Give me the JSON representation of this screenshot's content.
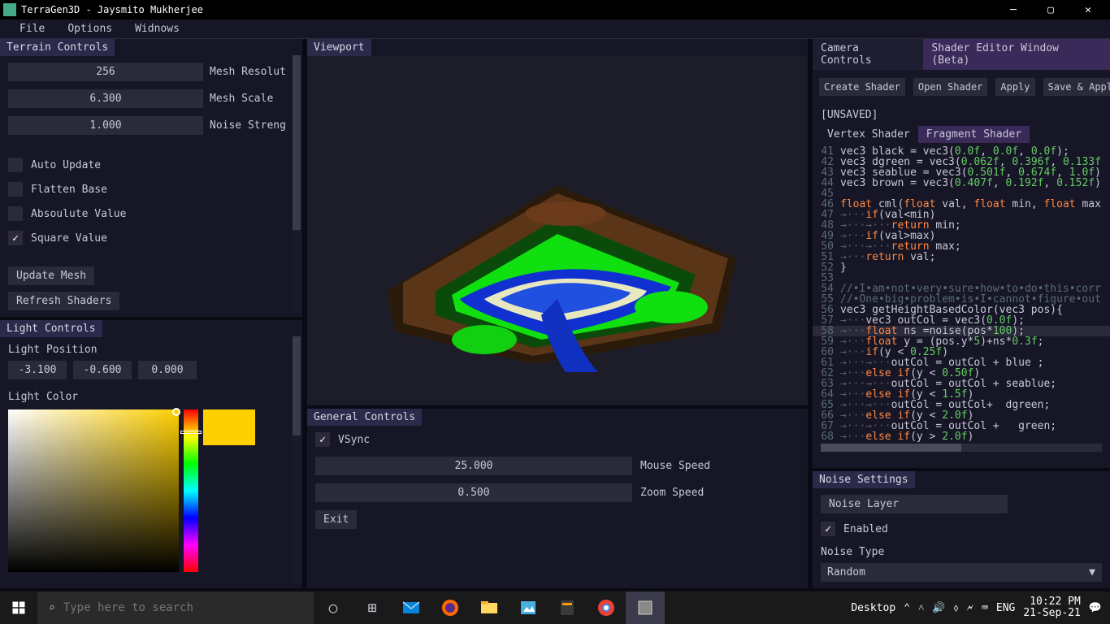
{
  "window": {
    "title": "TerraGen3D - Jaysmito Mukherjee"
  },
  "menu": {
    "file": "File",
    "options": "Options",
    "windows": "Widnows"
  },
  "terrain": {
    "title": "Terrain Controls",
    "mesh_res_val": "256",
    "mesh_res_lbl": "Mesh Resolut",
    "mesh_scale_val": "6.300",
    "mesh_scale_lbl": "Mesh Scale",
    "noise_strength_val": "1.000",
    "noise_strength_lbl": "Noise Streng",
    "auto_update": "Auto Update",
    "flatten_base": "Flatten Base",
    "absolute_value": "Absoulute Value",
    "square_value": "Square Value",
    "update_mesh": "Update Mesh",
    "refresh_shaders": "Refresh Shaders"
  },
  "light": {
    "title": "Light Controls",
    "pos_label": "Light Position",
    "x": "-3.100",
    "y": "-0.600",
    "z": "0.000",
    "color_label": "Light Color",
    "preview_hex": "#ffd000"
  },
  "viewport": {
    "title": "Viewport"
  },
  "general": {
    "title": "General Controls",
    "vsync": "VSync",
    "mouse_speed_val": "25.000",
    "mouse_speed_lbl": "Mouse Speed",
    "zoom_speed_val": "0.500",
    "zoom_speed_lbl": "Zoom Speed",
    "exit": "Exit"
  },
  "right_tabs": {
    "camera": "Camera Controls",
    "shader": "Shader Editor Window (Beta)"
  },
  "shader": {
    "create": "Create Shader",
    "open": "Open Shader",
    "apply": "Apply",
    "save": "Save & Appl",
    "unsaved": "[UNSAVED]",
    "vertex": "Vertex Shader",
    "fragment": "Fragment Shader",
    "lines": [
      {
        "n": 41,
        "html": "vec3 black = vec3(<span class='num'>0.0f</span>, <span class='num'>0.0f</span>, <span class='num'>0.0f</span>);"
      },
      {
        "n": 42,
        "html": "vec3 dgreen = vec3(<span class='num'>0.062f</span>, <span class='num'>0.396f</span>, <span class='num'>0.133f</span>"
      },
      {
        "n": 43,
        "html": "vec3 seablue = vec3(<span class='num'>0.501f</span>, <span class='num'>0.674f</span>, <span class='num'>1.0f</span>)"
      },
      {
        "n": 44,
        "html": "vec3 brown = vec3(<span class='num'>0.407f</span>, <span class='num'>0.192f</span>, <span class='num'>0.152f</span>)"
      },
      {
        "n": 45,
        "html": ""
      },
      {
        "n": 46,
        "html": "<span class='kw'>float</span> cml(<span class='kw'>float</span> val, <span class='kw'>float</span> min, <span class='kw'>float</span> max"
      },
      {
        "n": 47,
        "html": "<span class='arrow'>→···</span><span class='kw'>if</span>(val&lt;min)"
      },
      {
        "n": 48,
        "html": "<span class='arrow'>→···→···</span><span class='kw'>return</span> min;"
      },
      {
        "n": 49,
        "html": "<span class='arrow'>→···</span><span class='kw'>if</span>(val&gt;max)"
      },
      {
        "n": 50,
        "html": "<span class='arrow'>→···→···</span><span class='kw'>return</span> max;"
      },
      {
        "n": 51,
        "html": "<span class='arrow'>→···</span><span class='kw'>return</span> val;"
      },
      {
        "n": 52,
        "html": "}"
      },
      {
        "n": 53,
        "html": ""
      },
      {
        "n": 54,
        "html": "<span class='cmt'>//•I•am•not•very•sure•how•to•do•this•corr</span>"
      },
      {
        "n": 55,
        "html": "<span class='cmt'>//•One•big•problem•is•I•cannot•figure•out</span>"
      },
      {
        "n": 56,
        "html": "vec3 getHeightBasedColor(vec3 pos){"
      },
      {
        "n": 57,
        "html": "<span class='arrow'>→···</span>vec3 outCol = vec3(<span class='num'>0.0f</span>);"
      },
      {
        "n": 58,
        "html": "<span class='arrow'>→···</span><span class='kw'>float</span> ns =noise(pos*<span class='num'>100</span>);",
        "hl": true
      },
      {
        "n": 59,
        "html": "<span class='arrow'>→···</span><span class='kw'>float</span> y = (pos.y*<span class='num'>5</span>)+ns*<span class='num'>0.3f</span>;"
      },
      {
        "n": 60,
        "html": "<span class='arrow'>→···</span><span class='kw'>if</span>(y &lt; <span class='num'>0.25f</span>)"
      },
      {
        "n": 61,
        "html": "<span class='arrow'>→···→···</span>outCol = outCol + blue ;"
      },
      {
        "n": 62,
        "html": "<span class='arrow'>→···</span><span class='kw'>else if</span>(y &lt; <span class='num'>0.50f</span>)"
      },
      {
        "n": 63,
        "html": "<span class='arrow'>→···→···</span>outCol = outCol + seablue;"
      },
      {
        "n": 64,
        "html": "<span class='arrow'>→···</span><span class='kw'>else if</span>(y &lt; <span class='num'>1.5f</span>)"
      },
      {
        "n": 65,
        "html": "<span class='arrow'>→···→···</span>outCol = outCol+  dgreen;"
      },
      {
        "n": 66,
        "html": "<span class='arrow'>→···</span><span class='kw'>else if</span>(y &lt; <span class='num'>2.0f</span>)"
      },
      {
        "n": 67,
        "html": "<span class='arrow'>→···→···</span>outCol = outCol +   green;"
      },
      {
        "n": 68,
        "html": "<span class='arrow'>→···</span><span class='kw'>else if</span>(y &gt; <span class='num'>2.0f</span>)"
      }
    ]
  },
  "noise": {
    "title": "Noise Settings",
    "layer": "Noise Layer",
    "enabled": "Enabled",
    "type_label": "Noise Type",
    "type_value": "Random"
  },
  "taskbar": {
    "search_placeholder": "Type here to search",
    "desktop": "Desktop",
    "lang": "ENG",
    "time": "10:22 PM",
    "date": "21-Sep-21"
  }
}
